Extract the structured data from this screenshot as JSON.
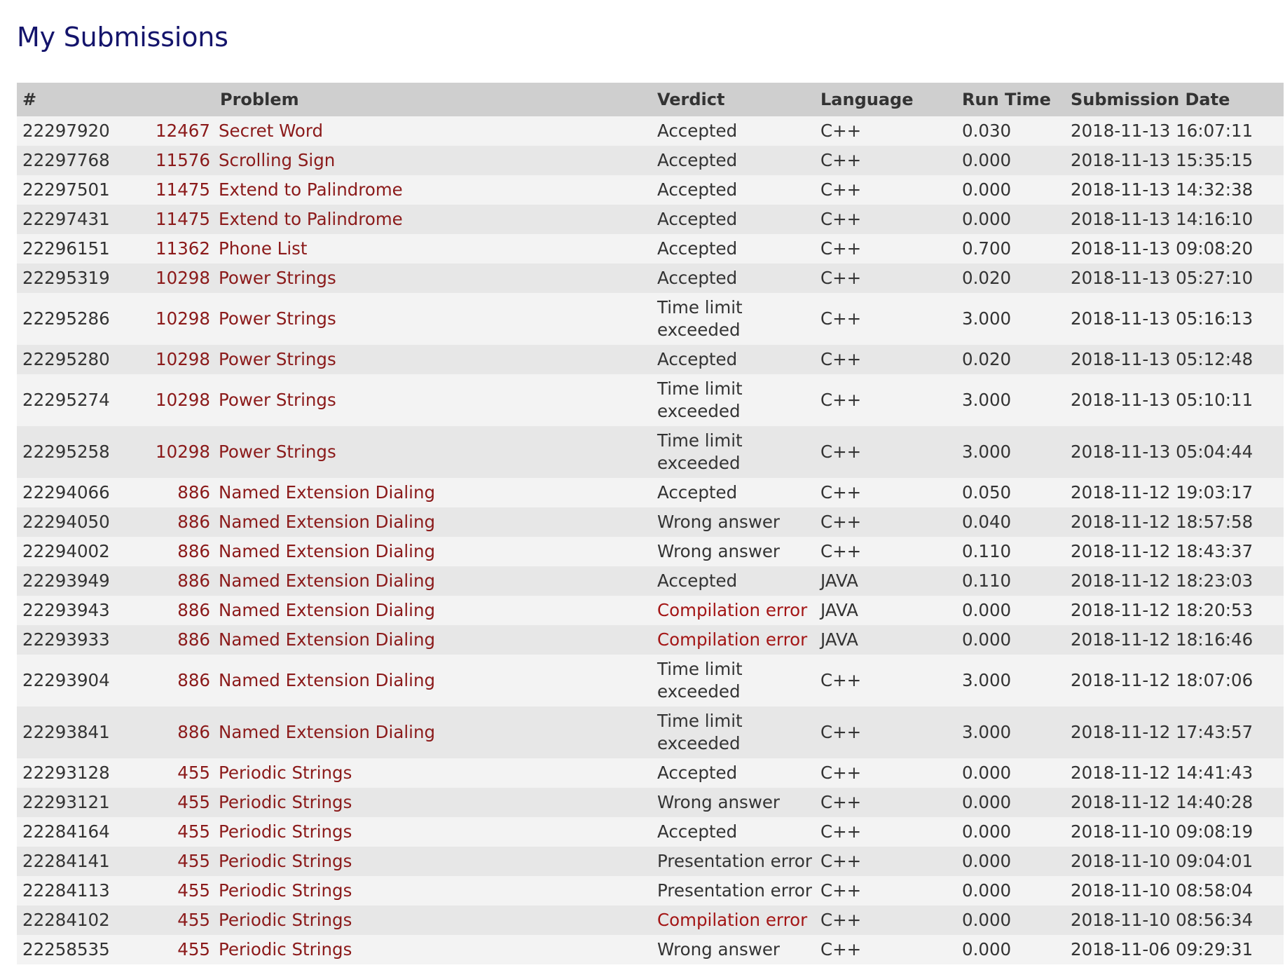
{
  "page": {
    "title": "My Submissions"
  },
  "table": {
    "headers": {
      "id": "#",
      "problem": "Problem",
      "verdict": "Verdict",
      "language": "Language",
      "run_time": "Run Time",
      "date": "Submission Date"
    },
    "rows": [
      {
        "id": "22297920",
        "num": "12467",
        "title": "Secret Word",
        "verdict": "Accepted",
        "lang": "C++",
        "time": "0.030",
        "date": "2018-11-13 16:07:11"
      },
      {
        "id": "22297768",
        "num": "11576",
        "title": "Scrolling Sign",
        "verdict": "Accepted",
        "lang": "C++",
        "time": "0.000",
        "date": "2018-11-13 15:35:15"
      },
      {
        "id": "22297501",
        "num": "11475",
        "title": "Extend to Palindrome",
        "verdict": "Accepted",
        "lang": "C++",
        "time": "0.000",
        "date": "2018-11-13 14:32:38"
      },
      {
        "id": "22297431",
        "num": "11475",
        "title": "Extend to Palindrome",
        "verdict": "Accepted",
        "lang": "C++",
        "time": "0.000",
        "date": "2018-11-13 14:16:10"
      },
      {
        "id": "22296151",
        "num": "11362",
        "title": "Phone List",
        "verdict": "Accepted",
        "lang": "C++",
        "time": "0.700",
        "date": "2018-11-13 09:08:20"
      },
      {
        "id": "22295319",
        "num": "10298",
        "title": "Power Strings",
        "verdict": "Accepted",
        "lang": "C++",
        "time": "0.020",
        "date": "2018-11-13 05:27:10"
      },
      {
        "id": "22295286",
        "num": "10298",
        "title": "Power Strings",
        "verdict": "Time limit exceeded",
        "lang": "C++",
        "time": "3.000",
        "date": "2018-11-13 05:16:13"
      },
      {
        "id": "22295280",
        "num": "10298",
        "title": "Power Strings",
        "verdict": "Accepted",
        "lang": "C++",
        "time": "0.020",
        "date": "2018-11-13 05:12:48"
      },
      {
        "id": "22295274",
        "num": "10298",
        "title": "Power Strings",
        "verdict": "Time limit exceeded",
        "lang": "C++",
        "time": "3.000",
        "date": "2018-11-13 05:10:11"
      },
      {
        "id": "22295258",
        "num": "10298",
        "title": "Power Strings",
        "verdict": "Time limit exceeded",
        "lang": "C++",
        "time": "3.000",
        "date": "2018-11-13 05:04:44"
      },
      {
        "id": "22294066",
        "num": "886",
        "title": "Named Extension Dialing",
        "verdict": "Accepted",
        "lang": "C++",
        "time": "0.050",
        "date": "2018-11-12 19:03:17"
      },
      {
        "id": "22294050",
        "num": "886",
        "title": "Named Extension Dialing",
        "verdict": "Wrong answer",
        "lang": "C++",
        "time": "0.040",
        "date": "2018-11-12 18:57:58"
      },
      {
        "id": "22294002",
        "num": "886",
        "title": "Named Extension Dialing",
        "verdict": "Wrong answer",
        "lang": "C++",
        "time": "0.110",
        "date": "2018-11-12 18:43:37"
      },
      {
        "id": "22293949",
        "num": "886",
        "title": "Named Extension Dialing",
        "verdict": "Accepted",
        "lang": "JAVA",
        "time": "0.110",
        "date": "2018-11-12 18:23:03"
      },
      {
        "id": "22293943",
        "num": "886",
        "title": "Named Extension Dialing",
        "verdict": "Compilation error",
        "lang": "JAVA",
        "time": "0.000",
        "date": "2018-11-12 18:20:53"
      },
      {
        "id": "22293933",
        "num": "886",
        "title": "Named Extension Dialing",
        "verdict": "Compilation error",
        "lang": "JAVA",
        "time": "0.000",
        "date": "2018-11-12 18:16:46"
      },
      {
        "id": "22293904",
        "num": "886",
        "title": "Named Extension Dialing",
        "verdict": "Time limit exceeded",
        "lang": "C++",
        "time": "3.000",
        "date": "2018-11-12 18:07:06"
      },
      {
        "id": "22293841",
        "num": "886",
        "title": "Named Extension Dialing",
        "verdict": "Time limit exceeded",
        "lang": "C++",
        "time": "3.000",
        "date": "2018-11-12 17:43:57"
      },
      {
        "id": "22293128",
        "num": "455",
        "title": "Periodic Strings",
        "verdict": "Accepted",
        "lang": "C++",
        "time": "0.000",
        "date": "2018-11-12 14:41:43"
      },
      {
        "id": "22293121",
        "num": "455",
        "title": "Periodic Strings",
        "verdict": "Wrong answer",
        "lang": "C++",
        "time": "0.000",
        "date": "2018-11-12 14:40:28"
      },
      {
        "id": "22284164",
        "num": "455",
        "title": "Periodic Strings",
        "verdict": "Accepted",
        "lang": "C++",
        "time": "0.000",
        "date": "2018-11-10 09:08:19"
      },
      {
        "id": "22284141",
        "num": "455",
        "title": "Periodic Strings",
        "verdict": "Presentation error",
        "lang": "C++",
        "time": "0.000",
        "date": "2018-11-10 09:04:01"
      },
      {
        "id": "22284113",
        "num": "455",
        "title": "Periodic Strings",
        "verdict": "Presentation error",
        "lang": "C++",
        "time": "0.000",
        "date": "2018-11-10 08:58:04"
      },
      {
        "id": "22284102",
        "num": "455",
        "title": "Periodic Strings",
        "verdict": "Compilation error",
        "lang": "C++",
        "time": "0.000",
        "date": "2018-11-10 08:56:34"
      },
      {
        "id": "22258535",
        "num": "455",
        "title": "Periodic Strings",
        "verdict": "Wrong answer",
        "lang": "C++",
        "time": "0.000",
        "date": "2018-11-06 09:29:31"
      }
    ]
  },
  "colors": {
    "title": "#14146b",
    "link": "#8b1a1a",
    "error_verdict": "#a31515",
    "header_bg": "#cfcfcf",
    "row_light": "#f3f3f3",
    "row_dark": "#e7e7e7"
  }
}
